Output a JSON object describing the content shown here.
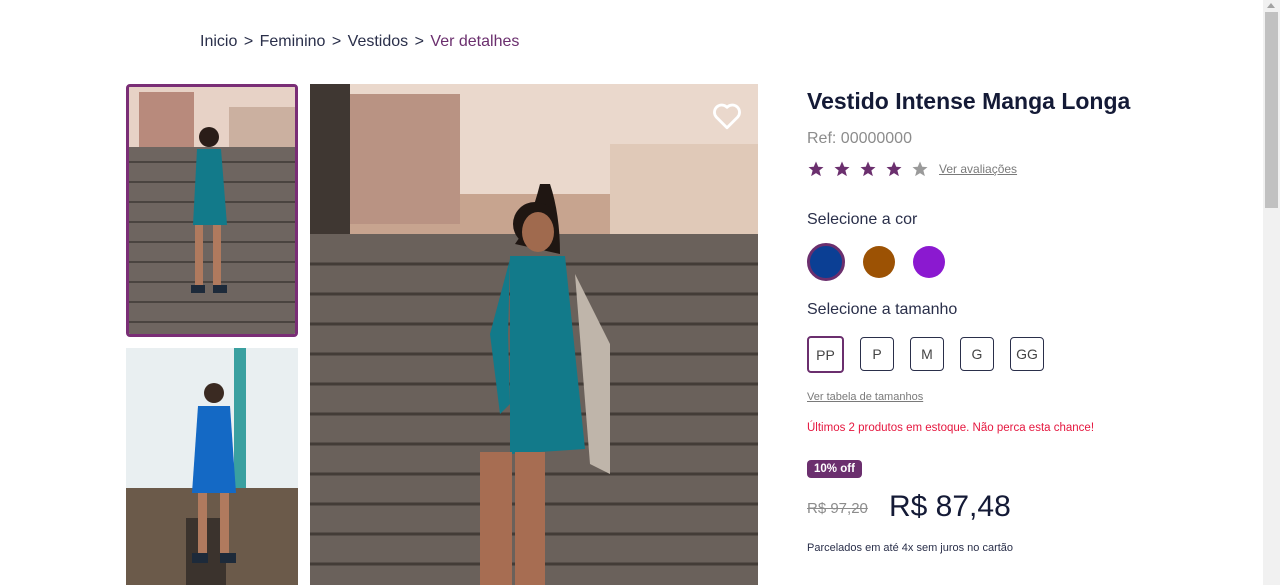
{
  "breadcrumb": {
    "items": [
      "Inicio",
      "Feminino",
      "Vestidos"
    ],
    "separator": ">",
    "current": "Ver detalhes"
  },
  "product": {
    "title": "Vestido Intense Manga Longa",
    "ref": "Ref: 00000000",
    "rating": 4,
    "rating_max": 5,
    "reviews_link": "Ver avaliações",
    "color_label": "Selecione a cor",
    "colors": [
      "#0b3f94",
      "#9c5204",
      "#8b19d0"
    ],
    "selected_color_index": 0,
    "size_label": "Selecione a tamanho",
    "sizes": [
      "PP",
      "P",
      "M",
      "G",
      "GG"
    ],
    "selected_size": "PP",
    "size_table_link": "Ver tabela de tamanhos",
    "stock_notice": "Últimos 2 produtos em estoque. Não perca esta chance!",
    "discount_badge": "10% off",
    "old_price": "R$ 97,20",
    "price": "R$ 87,48",
    "installments": "Parcelados em até 4x sem juros no cartão"
  },
  "colors": {
    "accent": "#6b2f6e",
    "star_filled": "#6b2f6e",
    "star_empty": "#9a9a9a",
    "stock_text": "#e5173f",
    "dress": "#127a8a"
  },
  "icons": {
    "favorite": "heart-outline-icon",
    "star": "star-icon"
  }
}
